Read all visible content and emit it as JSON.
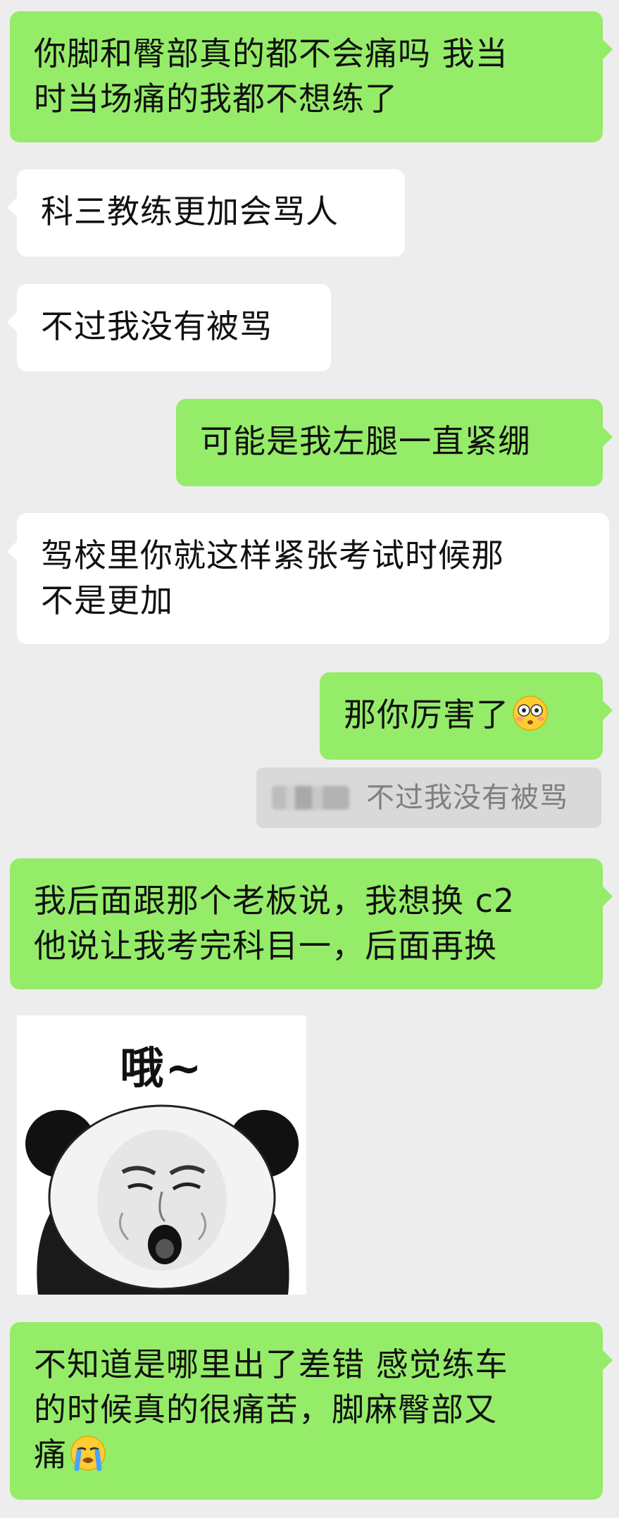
{
  "messages": [
    {
      "type": "text",
      "side": "right",
      "lines": [
        "你脚和臀部真的都不会痛吗  我当",
        "时当场痛的我都不想练了"
      ]
    },
    {
      "type": "text",
      "side": "left",
      "lines": [
        "科三教练更加会骂人"
      ]
    },
    {
      "type": "text",
      "side": "left",
      "lines": [
        "不过我没有被骂"
      ]
    },
    {
      "type": "text",
      "side": "right",
      "lines": [
        "可能是我左腿一直紧绷"
      ]
    },
    {
      "type": "text",
      "side": "left",
      "lines": [
        "驾校里你就这样紧张考试时候那",
        "不是更加"
      ]
    },
    {
      "type": "text",
      "side": "right",
      "lines": [
        "那你厉害了"
      ],
      "emoji": "flushed-face"
    },
    {
      "type": "quote",
      "text": "不过我没有被骂"
    },
    {
      "type": "text",
      "side": "right",
      "lines": [
        "我后面跟那个老板说，我想换 c2",
        "他说让我考完科目一，后面再换"
      ]
    },
    {
      "type": "sticker",
      "side": "left",
      "caption": "哦~",
      "icon": "panda-face-meme"
    },
    {
      "type": "text",
      "side": "right",
      "lines": [
        "不知道是哪里出了差错  感觉练车",
        "的时候真的很痛苦，脚麻臀部又",
        "痛"
      ],
      "emoji": "loudly-crying-face"
    }
  ],
  "colors": {
    "background": "#ededed",
    "outgoing_bubble": "#95ec69",
    "incoming_bubble": "#ffffff",
    "quote_bg": "#d9d9d9",
    "quote_text": "#7f7f7f"
  }
}
